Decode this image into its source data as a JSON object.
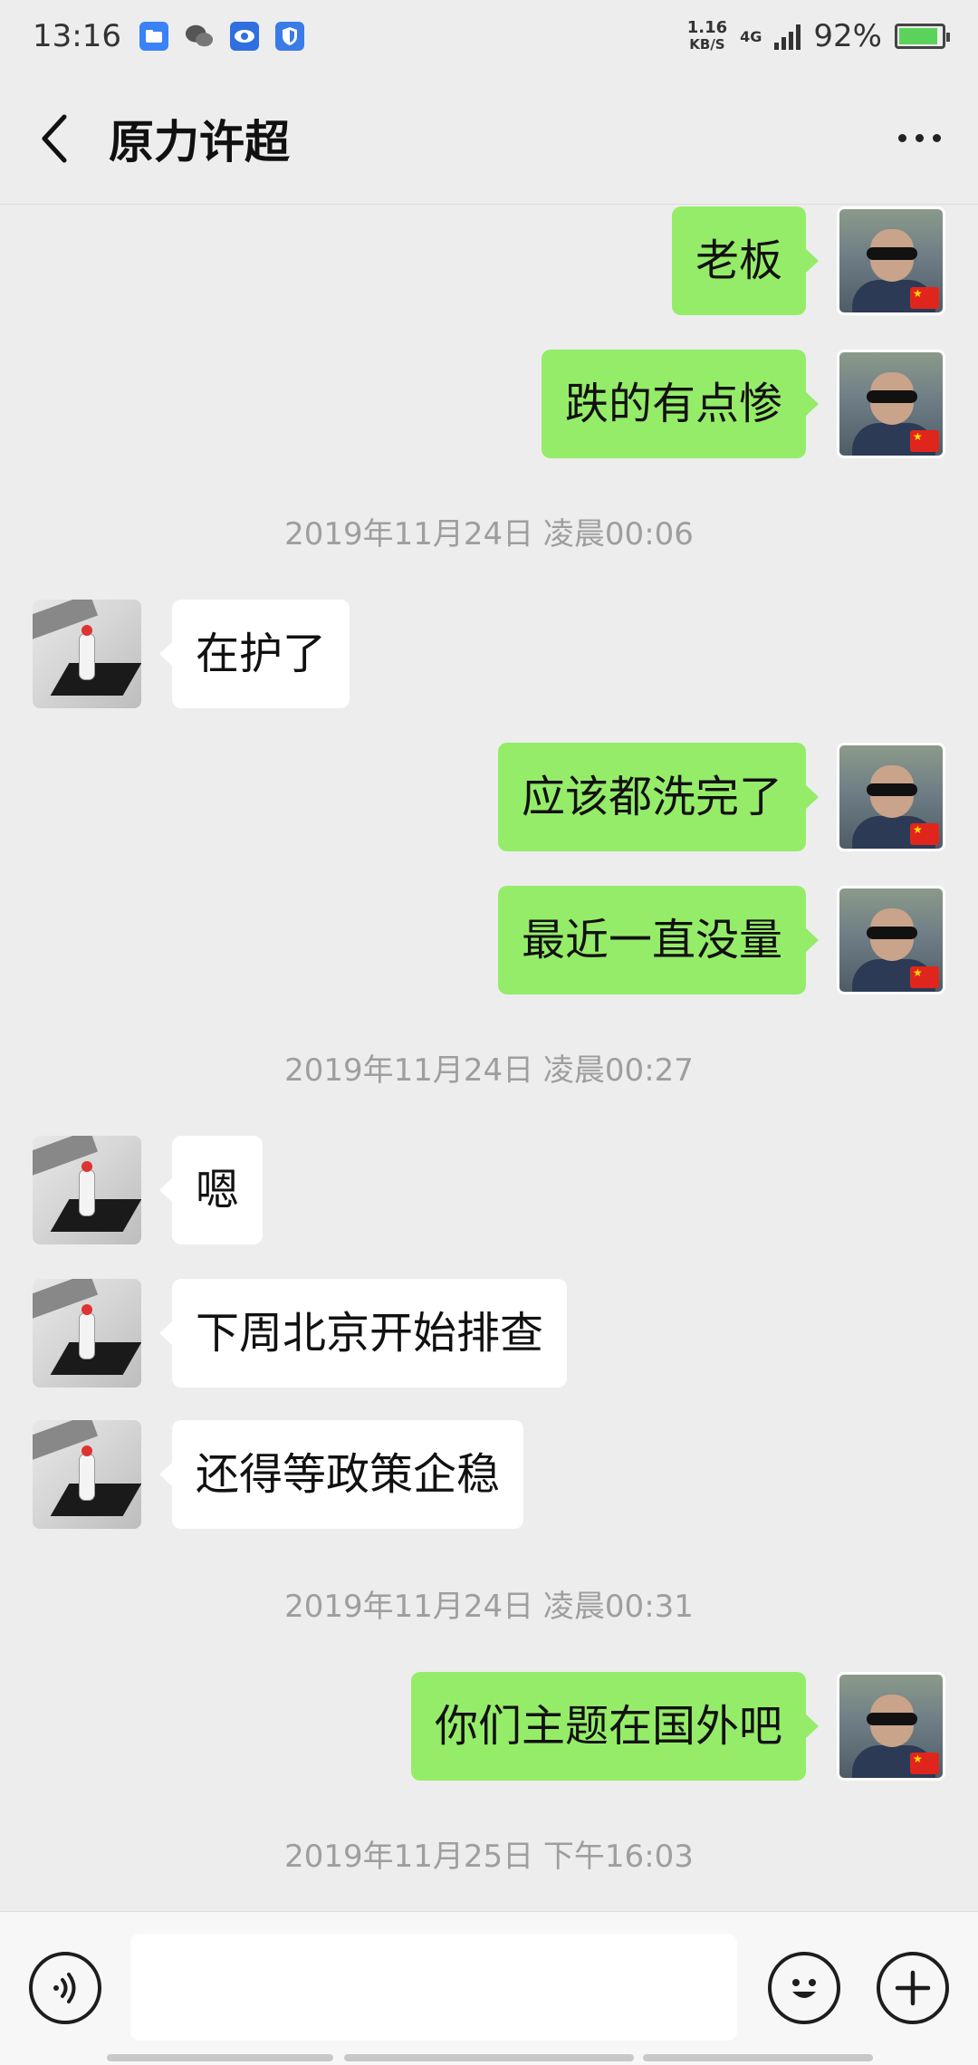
{
  "status_bar": {
    "time": "13:16",
    "net_speed_value": "1.16",
    "net_speed_unit": "KB/S",
    "network": "4G",
    "battery": "92%",
    "battery_level": 0.92,
    "icons": [
      "file-manager-icon",
      "wechat-icon",
      "eye-icon",
      "shield-icon"
    ]
  },
  "header": {
    "back_icon": "chevron-left-icon",
    "title": "原力许超",
    "more_icon": "more-icon"
  },
  "messages": [
    {
      "side": "right",
      "text": "老板"
    },
    {
      "side": "right",
      "text": "跌的有点惨"
    },
    {
      "timestamp": "2019年11月24日 凌晨00:06"
    },
    {
      "side": "left",
      "text": "在护了"
    },
    {
      "side": "right",
      "text": "应该都洗完了"
    },
    {
      "side": "right",
      "text": "最近一直没量"
    },
    {
      "timestamp": "2019年11月24日 凌晨00:27"
    },
    {
      "side": "left",
      "text": "嗯"
    },
    {
      "side": "left",
      "text": "下周北京开始排查"
    },
    {
      "side": "left",
      "text": "还得等政策企稳"
    },
    {
      "timestamp": "2019年11月24日 凌晨00:31"
    },
    {
      "side": "right",
      "text": "你们主题在国外吧"
    },
    {
      "timestamp": "2019年11月25日 下午16:03"
    }
  ],
  "input_bar": {
    "voice_icon": "voice-icon",
    "input_value": "",
    "emoji_icon": "emoji-icon",
    "plus_icon": "plus-icon"
  },
  "colors": {
    "background": "#ededed",
    "outgoing_bubble": "#95ec69",
    "incoming_bubble": "#ffffff",
    "timestamp_text": "#9e9e9e"
  }
}
